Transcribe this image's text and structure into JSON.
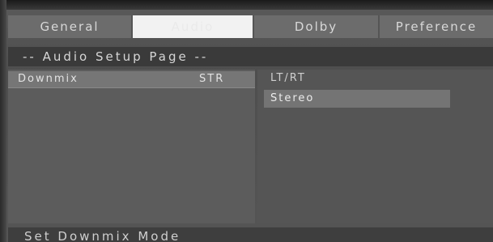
{
  "tabs": [
    {
      "label": "General",
      "selected": false
    },
    {
      "label": "Audio",
      "selected": true
    },
    {
      "label": "Dolby",
      "selected": false
    },
    {
      "label": "Preference",
      "selected": false
    }
  ],
  "page_title": "-- Audio Setup Page --",
  "settings": [
    {
      "label": "Downmix",
      "value": "STR"
    }
  ],
  "options": [
    {
      "label": "LT/RT",
      "highlighted": false
    },
    {
      "label": "Stereo",
      "highlighted": true
    }
  ],
  "status_text": "Set Downmix Mode"
}
